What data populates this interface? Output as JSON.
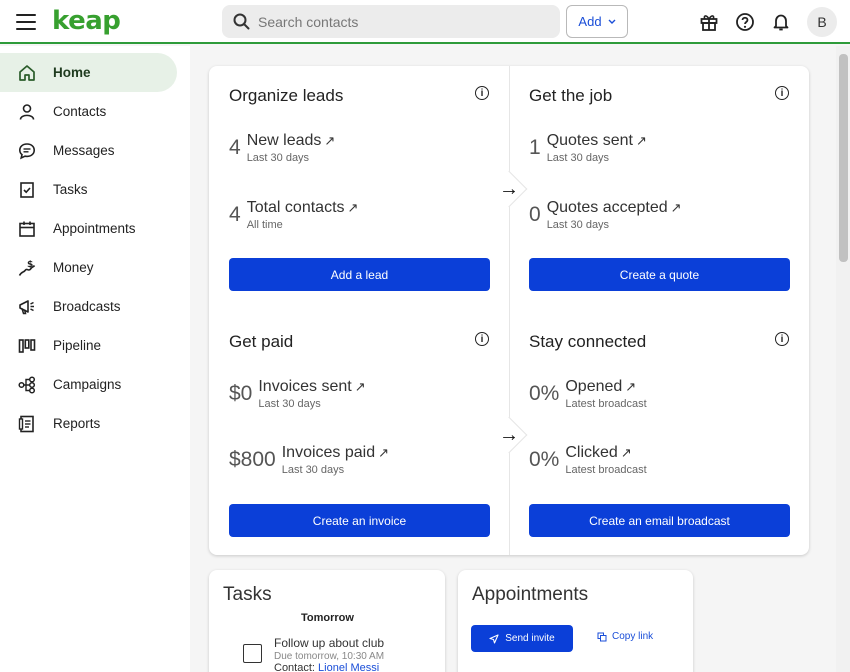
{
  "header": {
    "logo": "keap",
    "search_placeholder": "Search contacts",
    "add_label": "Add",
    "avatar_initial": "B",
    "icons": [
      "gift-icon",
      "help-icon",
      "bell-icon"
    ]
  },
  "sidebar": {
    "items": [
      {
        "label": "Home",
        "icon": "home-icon",
        "active": true
      },
      {
        "label": "Contacts",
        "icon": "person-icon"
      },
      {
        "label": "Messages",
        "icon": "chat-icon"
      },
      {
        "label": "Tasks",
        "icon": "task-icon"
      },
      {
        "label": "Appointments",
        "icon": "calendar-icon"
      },
      {
        "label": "Money",
        "icon": "money-icon"
      },
      {
        "label": "Broadcasts",
        "icon": "megaphone-icon"
      },
      {
        "label": "Pipeline",
        "icon": "pipeline-icon"
      },
      {
        "label": "Campaigns",
        "icon": "campaign-icon"
      },
      {
        "label": "Reports",
        "icon": "report-icon"
      }
    ]
  },
  "dashboard": {
    "organize": {
      "title": "Organize leads",
      "metrics": [
        {
          "value": "4",
          "label": "New leads",
          "sub": "Last 30 days"
        },
        {
          "value": "4",
          "label": "Total contacts",
          "sub": "All time"
        }
      ],
      "button": "Add a lead"
    },
    "job": {
      "title": "Get the job",
      "metrics": [
        {
          "value": "1",
          "label": "Quotes sent",
          "sub": "Last 30 days"
        },
        {
          "value": "0",
          "label": "Quotes accepted",
          "sub": "Last 30 days"
        }
      ],
      "button": "Create a quote"
    },
    "paid": {
      "title": "Get paid",
      "metrics": [
        {
          "value": "$0",
          "label": "Invoices sent",
          "sub": "Last 30 days"
        },
        {
          "value": "$800",
          "label": "Invoices paid",
          "sub": "Last 30 days"
        }
      ],
      "button": "Create an invoice"
    },
    "connected": {
      "title": "Stay connected",
      "metrics": [
        {
          "value": "0%",
          "label": "Opened",
          "sub": "Latest broadcast"
        },
        {
          "value": "0%",
          "label": "Clicked",
          "sub": "Latest broadcast"
        }
      ],
      "button": "Create an email broadcast"
    },
    "info_glyph": "i",
    "link_arrow": "↗",
    "flow_arrow": "→"
  },
  "tasks": {
    "title": "Tasks",
    "subtitle": "Tomorrow",
    "item": {
      "title": "Follow up about club",
      "due": "Due tomorrow, 10:30 AM",
      "contact_prefix": "Contact: ",
      "contact_name": "Lionel Messi"
    }
  },
  "appointments": {
    "title": "Appointments",
    "send_invite": "Send invite",
    "copy_link": "Copy link"
  }
}
